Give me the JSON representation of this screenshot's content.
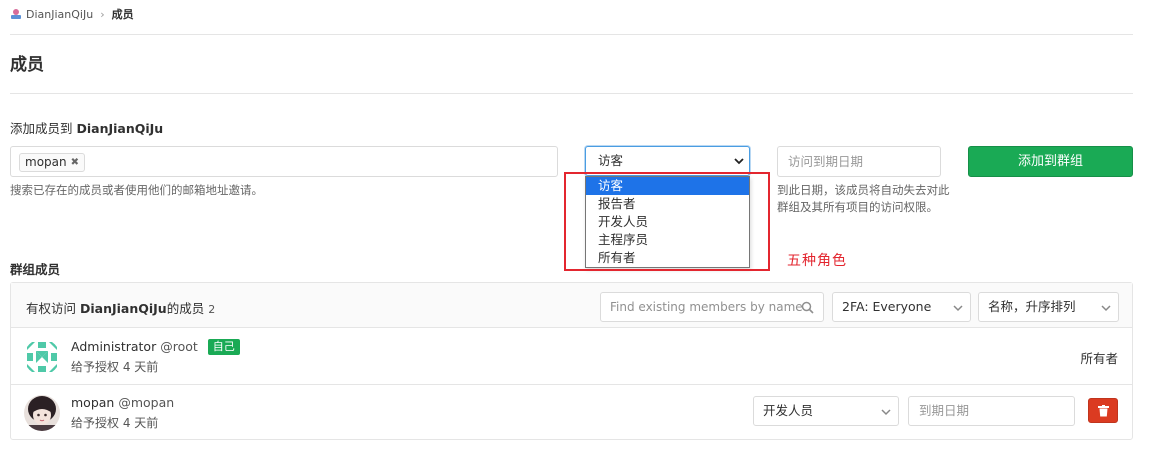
{
  "breadcrumb": {
    "group": "DianJianQiJu",
    "current": "成员"
  },
  "page_title": "成员",
  "add_form": {
    "label_prefix": "添加成员到 ",
    "group_name": "DianJianQiJu",
    "token": "mopan",
    "invite_help": "搜索已存在的成员或者使用他们的邮箱地址邀请。",
    "role_selected": "访客",
    "role_options": [
      "访客",
      "报告者",
      "开发人员",
      "主程序员",
      "所有者"
    ],
    "date_placeholder": "访问到期日期",
    "date_help": "到此日期，该成员将自动失去对此群组及其所有项目的访问权限。",
    "add_button": "添加到群组"
  },
  "annotation": "五种角色",
  "group_members": {
    "title": "群组成员",
    "header_prefix": "有权访问 ",
    "header_group": "DianJianQiJu",
    "header_suffix": "的成员",
    "count": "2",
    "search_placeholder": "Find existing members by name",
    "twofa_filter": "2FA: Everyone",
    "sort": "名称，升序排列"
  },
  "members": [
    {
      "name": "Administrator",
      "username": "@root",
      "badge": "自己",
      "granted": "给予授权 4 天前",
      "role": "所有者"
    },
    {
      "name": "mopan",
      "username": "@mopan",
      "granted": "给予授权 4 天前",
      "role": "开发人员",
      "date_placeholder": "到期日期"
    }
  ],
  "colors": {
    "primary_green": "#1aaa55",
    "danger_red": "#db3b21",
    "annotation_red": "#e3262f",
    "select_focus": "#1e73e8"
  }
}
